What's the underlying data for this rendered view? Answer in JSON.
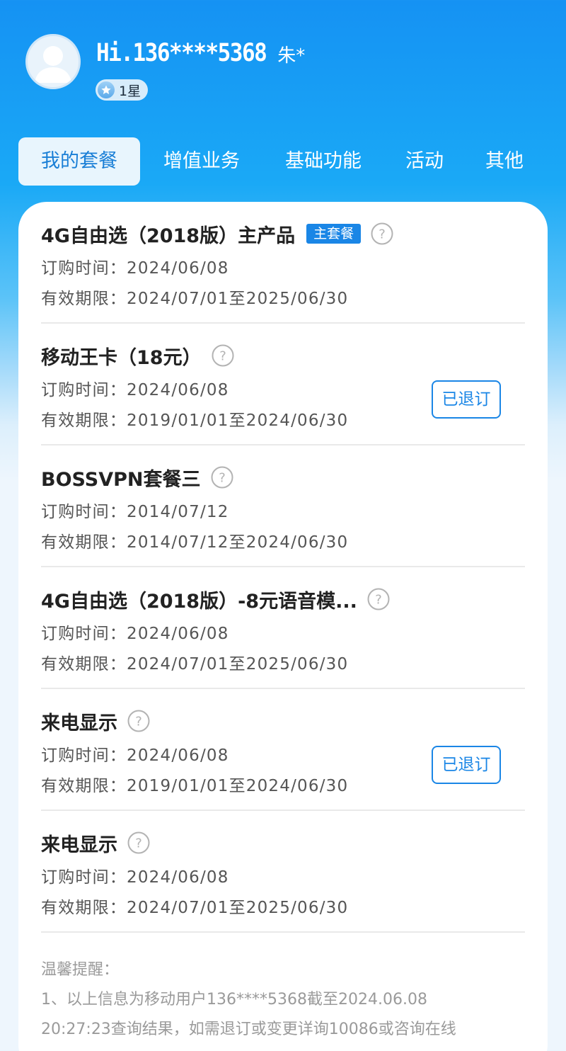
{
  "user": {
    "greeting": "Hi.136****5368",
    "name": "朱*",
    "level": "1星"
  },
  "tabs": [
    {
      "label": "我的套餐",
      "active": true
    },
    {
      "label": "增值业务",
      "active": false
    },
    {
      "label": "基础功能",
      "active": false
    },
    {
      "label": "活动",
      "active": false
    },
    {
      "label": "其他",
      "active": false
    }
  ],
  "items": [
    {
      "title": "4G自由选（2018版）主产品",
      "tag": "主套餐",
      "order_time": "订购时间：2024/06/08",
      "validity": "有效期限：2024/07/01至2025/06/30"
    },
    {
      "title": "移动王卡（18元）",
      "order_time": "订购时间：2024/06/08",
      "validity": "有效期限：2019/01/01至2024/06/30",
      "status": "已退订"
    },
    {
      "title": "BOSSVPN套餐三",
      "order_time": "订购时间：2014/07/12",
      "validity": "有效期限：2014/07/12至2024/06/30"
    },
    {
      "title": "4G自由选（2018版）-8元语音模...",
      "order_time": "订购时间：2024/06/08",
      "validity": "有效期限：2024/07/01至2025/06/30"
    },
    {
      "title": "来电显示",
      "order_time": "订购时间：2024/06/08",
      "validity": "有效期限：2019/01/01至2024/06/30",
      "status": "已退订"
    },
    {
      "title": "来电显示",
      "order_time": "订购时间：2024/06/08",
      "validity": "有效期限：2024/07/01至2025/06/30"
    }
  ],
  "tips": {
    "title": "温馨提醒：",
    "line1": "1、以上信息为移动用户136****5368截至2024.06.08",
    "line2": "20:27:23查询结果，如需退订或变更详询10086或咨询在线"
  },
  "colors": {
    "header_blue": "#1592f3",
    "accent_blue": "#1a86e6",
    "active_tab_bg": "#e8f5fd"
  },
  "icons": [
    "avatar-placeholder-icon",
    "star-icon",
    "help-question-icon"
  ]
}
